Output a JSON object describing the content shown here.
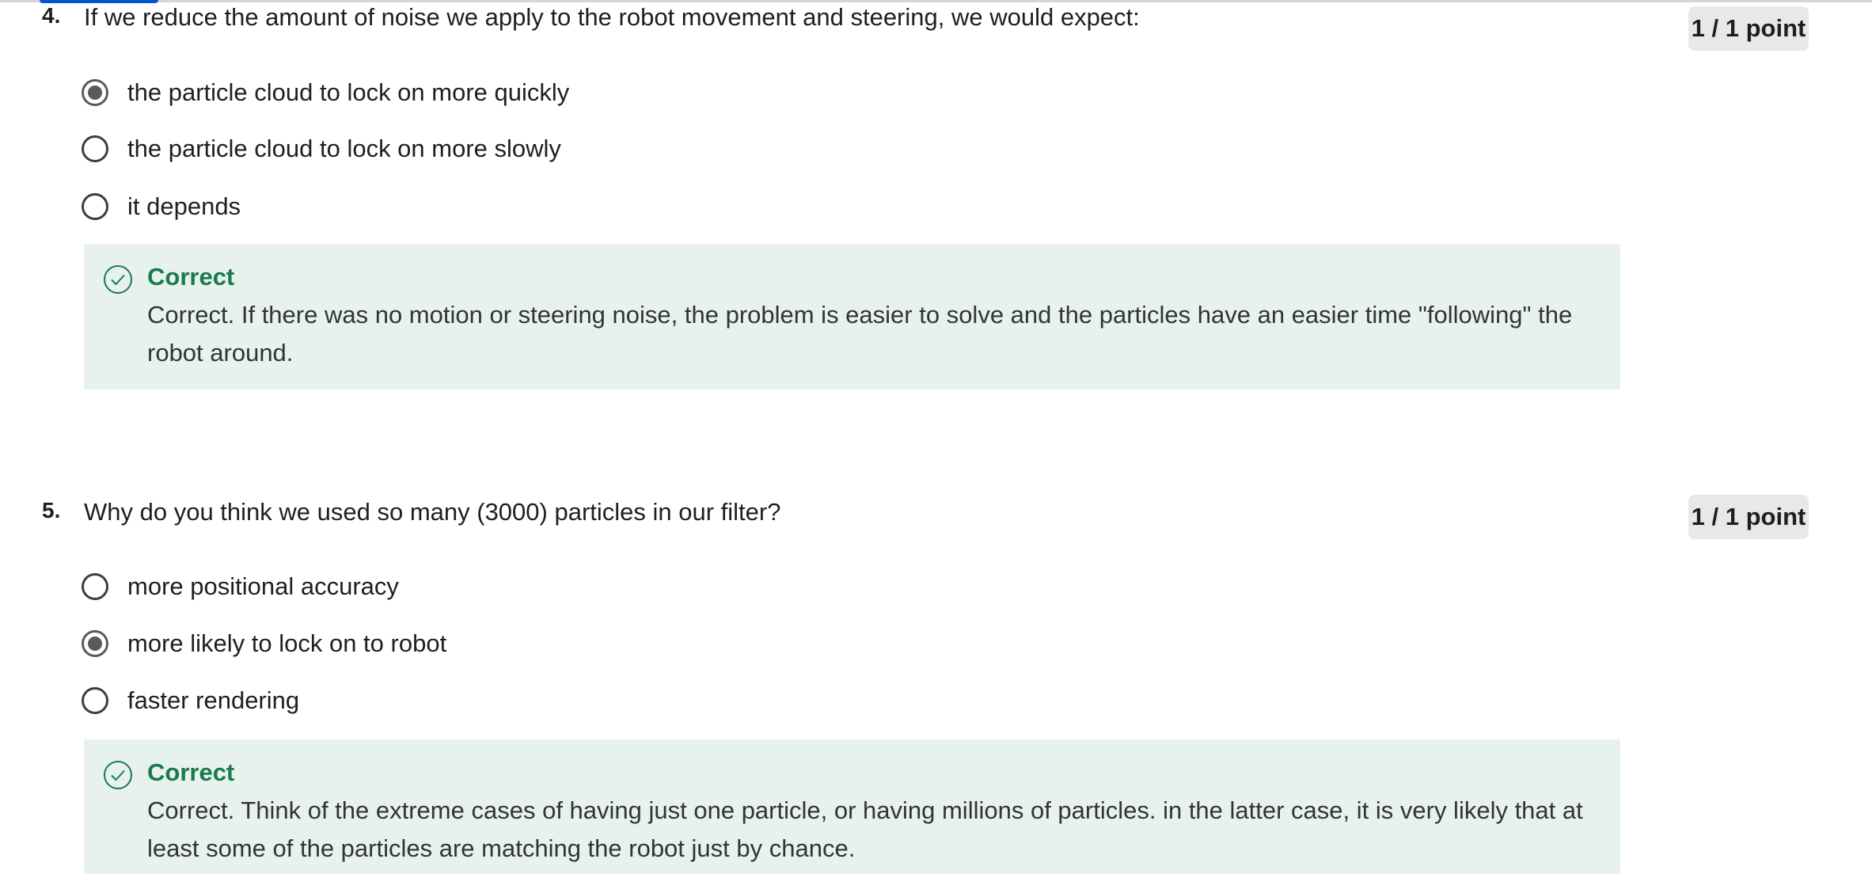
{
  "questions": [
    {
      "number": "4.",
      "text": "If we reduce the amount of noise we apply to the robot movement and steering, we would expect:",
      "points": "1 / 1 point",
      "options": [
        {
          "label": "the particle cloud to lock on more quickly",
          "selected": true
        },
        {
          "label": "the particle cloud to lock on more slowly",
          "selected": false
        },
        {
          "label": "it depends",
          "selected": false
        }
      ],
      "feedback": {
        "status": "Correct",
        "icon": "check-circle-icon",
        "text": "Correct.  If there was no motion or steering noise, the problem is easier to solve and the particles have an easier time \"following\" the robot around."
      }
    },
    {
      "number": "5.",
      "text": "Why do you think we used so many (3000) particles in our filter?",
      "points": "1 / 1 point",
      "options": [
        {
          "label": "more positional accuracy",
          "selected": false
        },
        {
          "label": "more likely to lock on to robot",
          "selected": true
        },
        {
          "label": "faster rendering",
          "selected": false
        }
      ],
      "feedback": {
        "status": "Correct",
        "icon": "check-circle-icon",
        "text": "Correct.  Think of the extreme cases of having just one particle, or having millions of particles.  in the latter case, it is very likely that at least some of the particles are matching the robot just by chance."
      }
    }
  ],
  "colors": {
    "correct_green": "#1b7a4a",
    "feedback_bg": "#e7f2ee",
    "points_bg": "#e8e8e8",
    "accent_blue": "#0056d2"
  }
}
